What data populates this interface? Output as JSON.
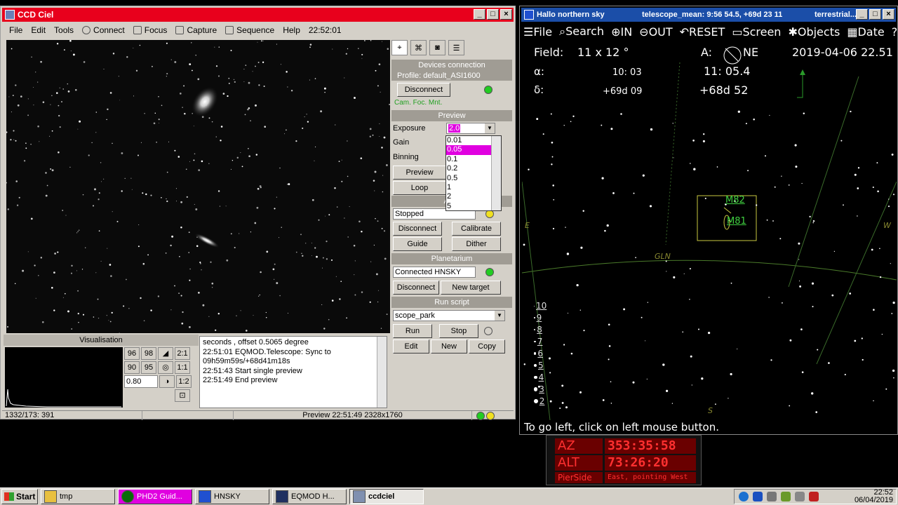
{
  "ccdciel": {
    "title": "CCD Ciel",
    "menu": [
      "File",
      "Edit",
      "Tools",
      "Connect",
      "Focus",
      "Capture",
      "Sequence",
      "Help"
    ],
    "menu_time": "22:52:01",
    "devices": {
      "header": "Devices connection",
      "profile": "Profile: default_ASI1600",
      "disconnect": "Disconnect",
      "sublabel": "Cam. Foc. Mnt."
    },
    "preview": {
      "header": "Preview",
      "exposure_label": "Exposure",
      "exposure_value": "2.0",
      "gain_label": "Gain",
      "binning_label": "Binning",
      "preview_button": "Preview",
      "loop_button": "Loop"
    },
    "exposure_options": [
      "0.01",
      "0.05",
      "0.1",
      "0.2",
      "0.5",
      "1",
      "2",
      "5"
    ],
    "exposure_selected": "0.05",
    "autoguider": {
      "header": "Auto",
      "status": "Stopped",
      "disconnect": "Disconnect",
      "calibrate": "Calibrate",
      "guide": "Guide",
      "dither": "Dither"
    },
    "planetarium": {
      "header": "Planetarium",
      "status": "Connected HNSKY",
      "disconnect": "Disconnect",
      "new_target": "New target"
    },
    "run_script": {
      "header": "Run script",
      "script": "scope_park",
      "run": "Run",
      "stop": "Stop",
      "edit": "Edit",
      "new": "New",
      "copy": "Copy"
    },
    "visualisation": {
      "header": "Visualisation",
      "values": [
        "96",
        "98",
        "90",
        "95"
      ],
      "gamma": "0.80",
      "zoom": [
        "2:1",
        "1:1",
        "1:2"
      ]
    },
    "log": [
      "seconds , offset 0.5065 degree",
      "22:51:01 EQMOD.Telescope: Sync to",
      "09h59m59s/+68d41m18s",
      "22:51:43 Start single preview",
      "22:51:49 End preview"
    ],
    "status": {
      "coords": "1332/173: 391",
      "preview": "Preview 22:51:49  2328x1760"
    }
  },
  "hnsky": {
    "title": "Hallo northern sky",
    "title_mid": "telescope_mean:  9:56 54.5,  +69d 23 11",
    "title_right": "terrestrial...",
    "menu": [
      "File",
      "Search",
      "IN",
      "OUT",
      "RESET",
      "Screen",
      "Objects",
      "Date",
      "? Help"
    ],
    "field_label": "Field:",
    "field_value": "11  x   12 °",
    "az_label": "A:",
    "az_dir": "NE",
    "datetime": "2019-04-06  22.51",
    "alpha_label": "α:",
    "alpha1": "10: 03",
    "alpha2": "11: 05.4",
    "delta_label": "δ:",
    "delta1": "+69d 09",
    "delta2": "+68d 52",
    "objects": [
      "M82",
      "M81"
    ],
    "horizon_labels": [
      "E",
      "W",
      "GLN",
      "S"
    ],
    "mag_scale": [
      "10",
      "9",
      "8",
      "7",
      "6",
      "5",
      "4",
      "3",
      "2"
    ],
    "status_text": "To go left, click on left mouse button."
  },
  "eqmod": {
    "az_label": "AZ",
    "az_value": "353:35:58",
    "alt_label": "ALT",
    "alt_value": "73:26:20",
    "pier_label": "PierSide",
    "pier_value": "East, pointing West"
  },
  "taskbar": {
    "start": "Start",
    "tasks": [
      "tmp",
      "PHD2 Guid...",
      "HNSKY",
      "EQMOD H...",
      "ccdciel"
    ],
    "clock_time": "22:52",
    "clock_date": "06/04/2019"
  }
}
